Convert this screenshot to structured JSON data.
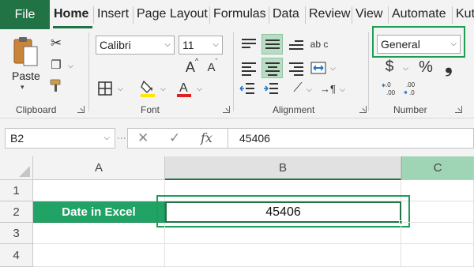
{
  "tabs": {
    "file": "File",
    "items": [
      "Home",
      "Insert",
      "Page Layout",
      "Formulas",
      "Data",
      "Review",
      "View",
      "Automate",
      "Kut"
    ]
  },
  "ribbon": {
    "clipboard": {
      "paste_label": "Paste",
      "group_label": "Clipboard"
    },
    "font": {
      "font_name": "Calibri",
      "font_size": "11",
      "grow_label": "A",
      "shrink_label": "A",
      "group_label": "Font",
      "highlight_color": "#ffe600",
      "font_color": "#e02020"
    },
    "alignment": {
      "group_label": "Alignment",
      "wrap_glyph": "ab c"
    },
    "number": {
      "format": "General",
      "currency": "$",
      "percent": "%",
      "comma": "❟",
      "group_label": "Number"
    }
  },
  "formula_bar": {
    "name_box": "B2",
    "cancel_glyph": "✕",
    "enter_glyph": "✓",
    "fx_label": "fx",
    "value": "45406"
  },
  "sheet": {
    "columns": [
      "A",
      "B",
      "C"
    ],
    "rows": [
      "1",
      "2",
      "3",
      "4"
    ],
    "a2": "Date in Excel",
    "b2": "45406"
  },
  "colors": {
    "accent": "#217346",
    "label_fill": "#21a366",
    "highlight_outline": "#1e9e55"
  }
}
